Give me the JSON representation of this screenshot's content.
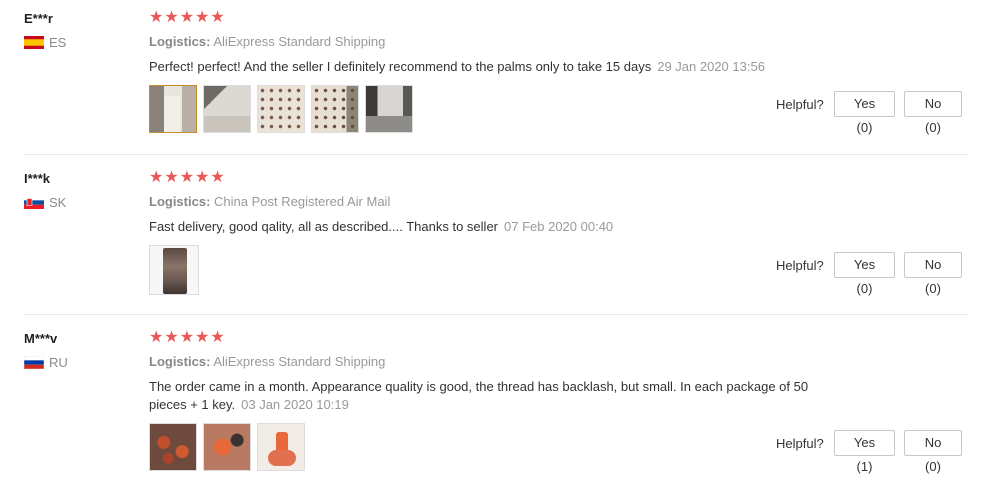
{
  "reviews": [
    {
      "name": "E***r",
      "country": "ES",
      "flag": "spain-flag",
      "stars": "★★★★★",
      "rating": 5,
      "logistics_label": "Logistics:",
      "logistics_value": "AliExpress Standard Shipping",
      "comment": "Perfect! perfect! And the seller I definitely recommend to the palms only to take 15 days",
      "date": "29 Jan 2020 13:56",
      "helpful_label": "Helpful?",
      "yes": "Yes (0)",
      "no": "No (0)"
    },
    {
      "name": "I***k",
      "country": "SK",
      "flag": "slovakia-flag",
      "stars": "★★★★★",
      "rating": 5,
      "logistics_label": "Logistics:",
      "logistics_value": "China Post Registered Air Mail",
      "comment": "Fast delivery, good qality, all as described.... Thanks to seller",
      "date": "07 Feb 2020 00:40",
      "helpful_label": "Helpful?",
      "yes": "Yes (0)",
      "no": "No (0)"
    },
    {
      "name": "M***v",
      "country": "RU",
      "flag": "russia-flag",
      "stars": "★★★★★",
      "rating": 5,
      "logistics_label": "Logistics:",
      "logistics_value": "AliExpress Standard Shipping",
      "comment": "The order came in a month. Appearance quality is good, the thread has backlash, but small. In each package of 50 pieces + 1 key.",
      "date": "03 Jan 2020 10:19",
      "helpful_label": "Helpful?",
      "yes": "Yes (1)",
      "no": "No (0)"
    }
  ],
  "colors": {
    "star": "#e8575a",
    "muted": "#999999",
    "active_thumb_border": "#c98a2c"
  }
}
